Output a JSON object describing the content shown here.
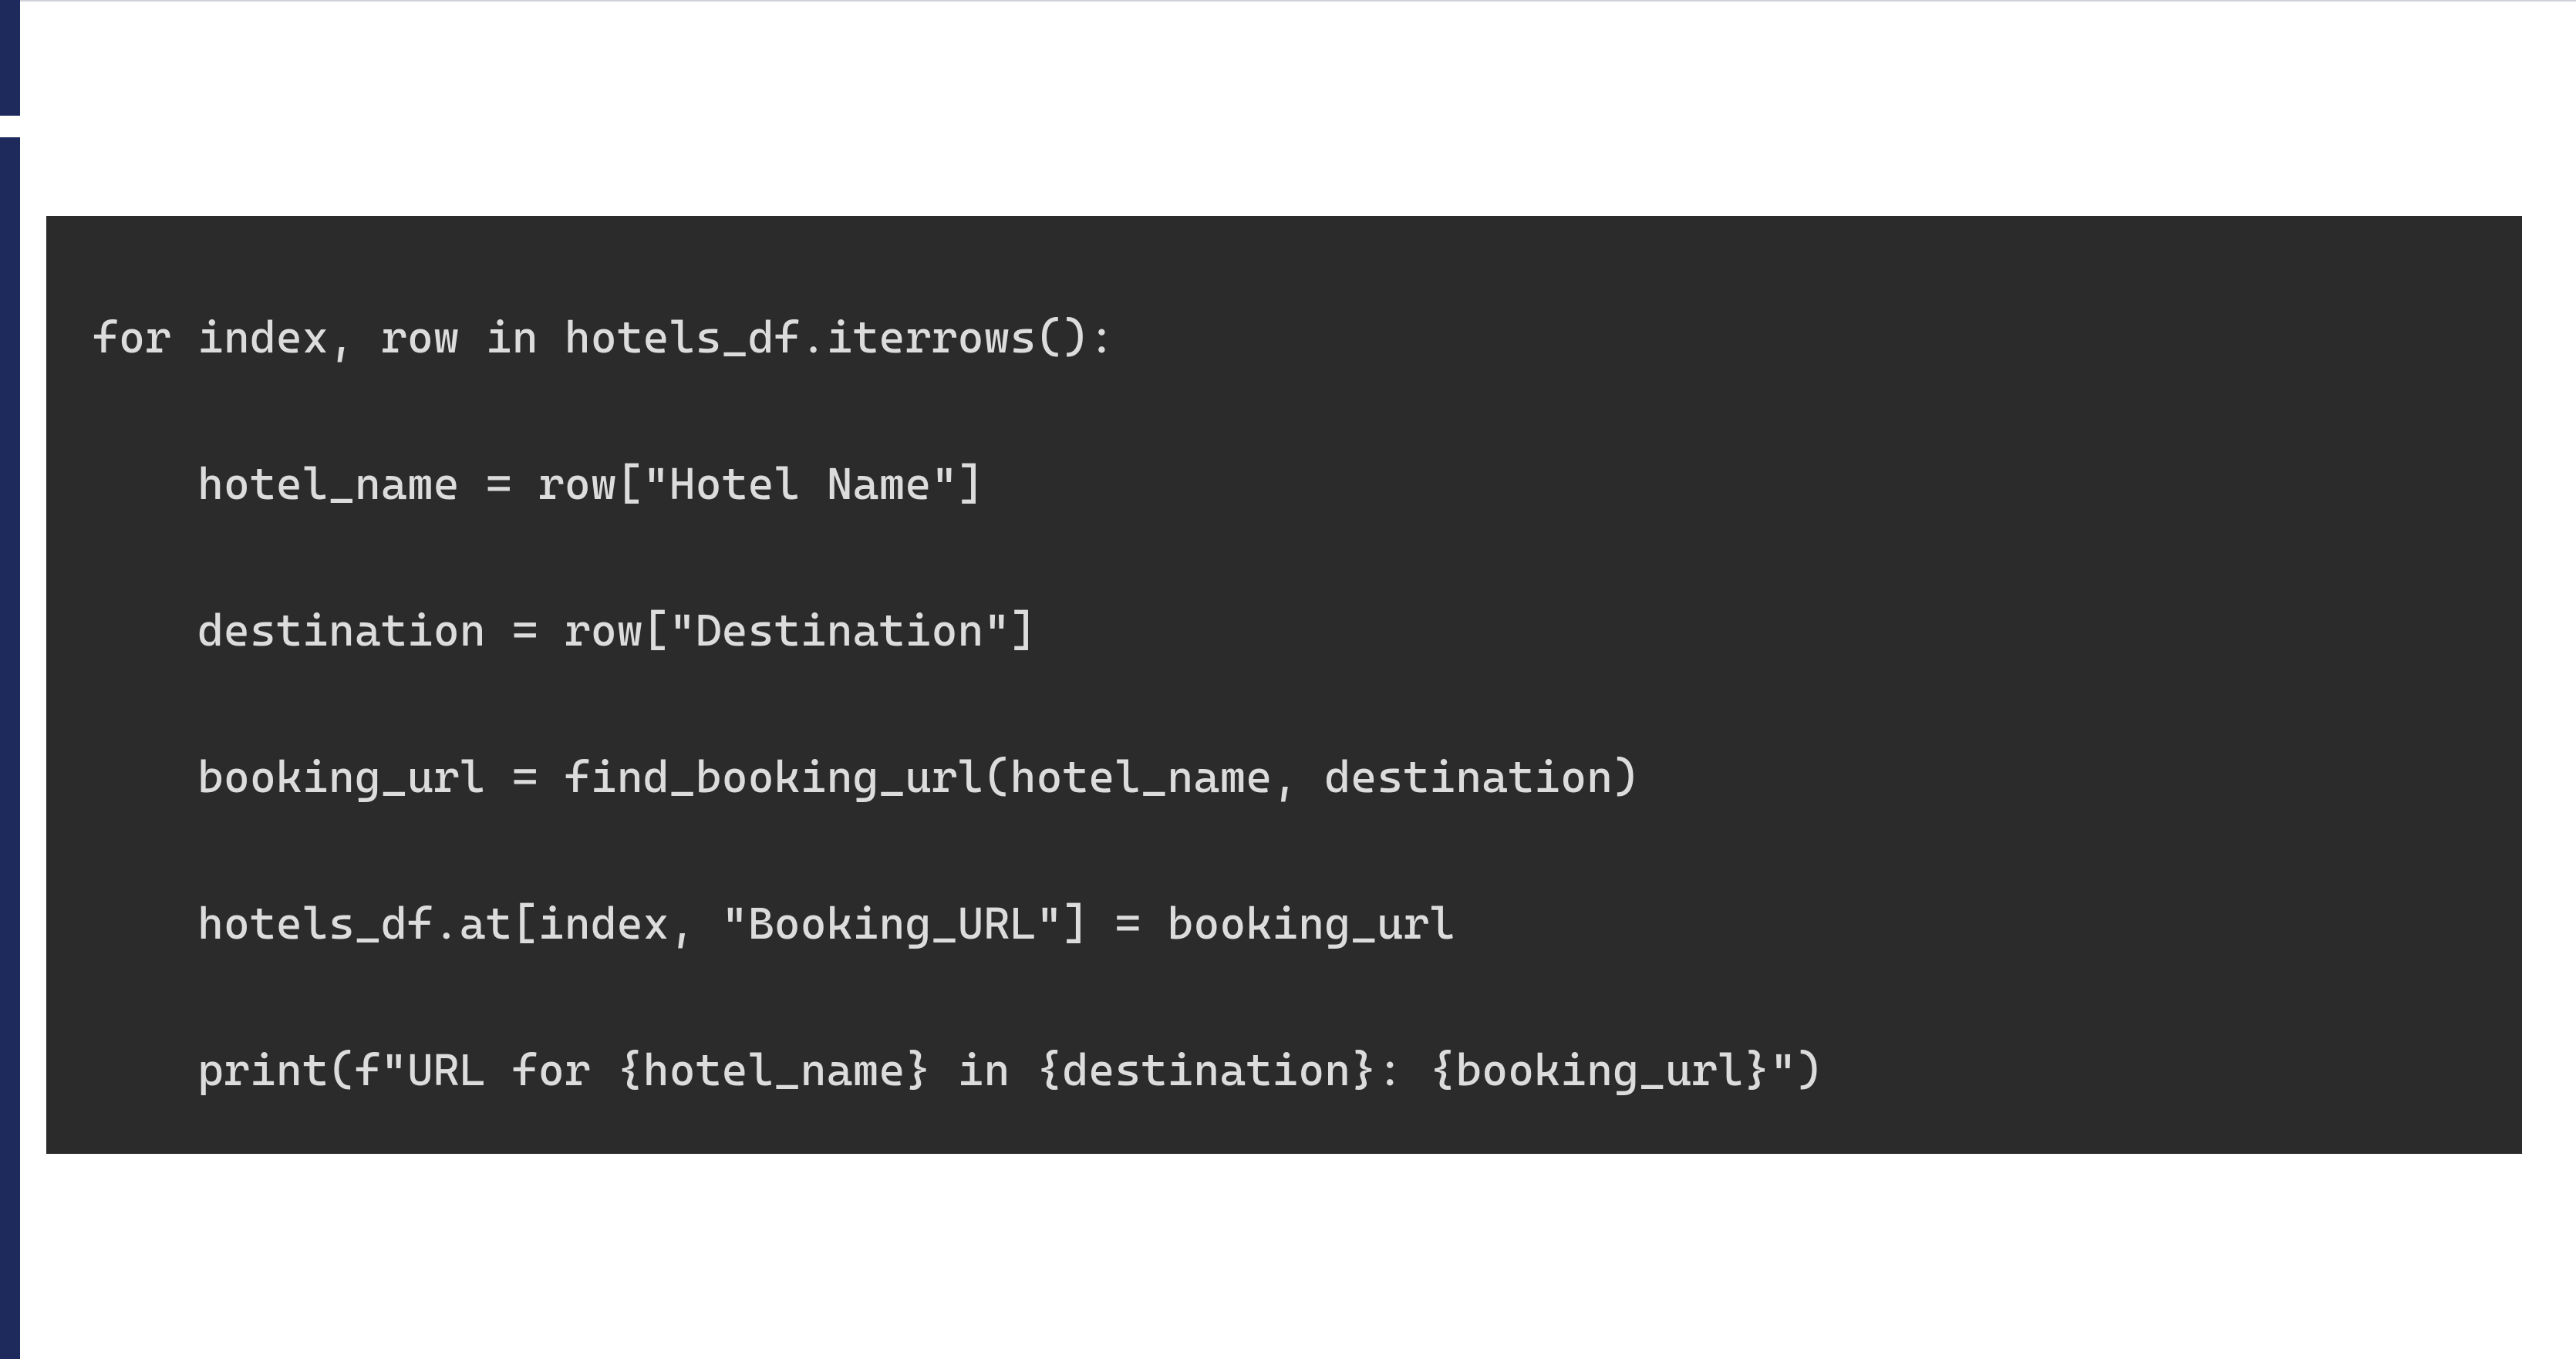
{
  "code": {
    "background": "#2b2b2b",
    "foreground": "#dcdcdc",
    "font": "Consolas",
    "lines": [
      "for index, row in hotels_df.iterrows():",
      "    hotel_name = row[\"Hotel Name\"]",
      "    destination = row[\"Destination\"]",
      "    booking_url = find_booking_url(hotel_name, destination)",
      "    hotels_df.at[index, \"Booking_URL\"] = booking_url",
      "    print(f\"URL for {hotel_name} in {destination}: {booking_url}\")"
    ]
  },
  "accent_color": "#1f2a5c"
}
